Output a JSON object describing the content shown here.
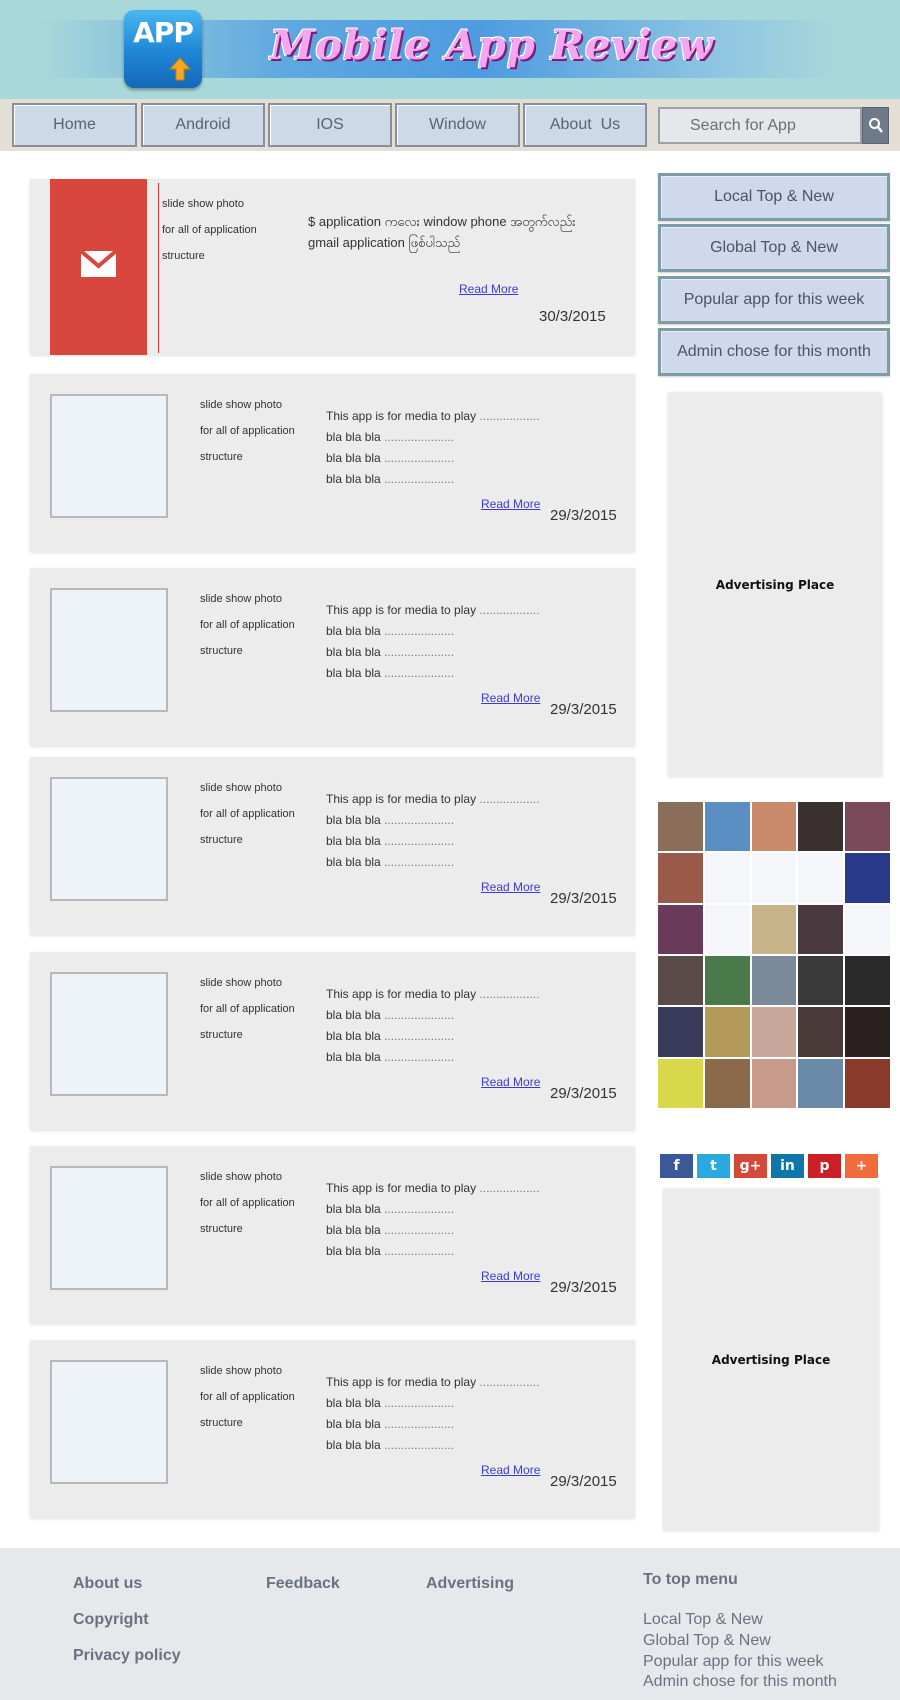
{
  "header": {
    "logo_text": "APP",
    "site_title": "Mobile App Review"
  },
  "nav": {
    "items": [
      "Home",
      "Android",
      "IOS",
      "Window",
      "About  Us"
    ],
    "search_placeholder": "Search for App"
  },
  "featured": {
    "meta": [
      "slide show photo",
      "for all of application",
      "structure"
    ],
    "description": "$ application ကလေး window phone အတွက်လည်း gmail application ဖြစ်ပါသည်",
    "read_more": "Read More",
    "date": "30/3/2015"
  },
  "posts": [
    {
      "meta": [
        "slide show photo",
        "for all of application",
        "structure"
      ],
      "lines": [
        "This app is for media to play",
        "bla bla bla",
        "bla bla bla",
        "bla bla bla"
      ],
      "read_more": "Read More",
      "date": "29/3/2015"
    },
    {
      "meta": [
        "slide show photo",
        "for all of application",
        "structure"
      ],
      "lines": [
        "This app is for media to play",
        "bla bla bla",
        "bla bla bla",
        "bla bla bla"
      ],
      "read_more": "Read More",
      "date": "29/3/2015"
    },
    {
      "meta": [
        "slide show photo",
        "for all of application",
        "structure"
      ],
      "lines": [
        "This app is for media to play",
        "bla bla bla",
        "bla bla bla",
        "bla bla bla"
      ],
      "read_more": "Read More",
      "date": "29/3/2015"
    },
    {
      "meta": [
        "slide show photo",
        "for all of application",
        "structure"
      ],
      "lines": [
        "This app is for media to play",
        "bla bla bla",
        "bla bla bla",
        "bla bla bla"
      ],
      "read_more": "Read More",
      "date": "29/3/2015"
    },
    {
      "meta": [
        "slide show photo",
        "for all of application",
        "structure"
      ],
      "lines": [
        "This app is for media to play",
        "bla bla bla",
        "bla bla bla",
        "bla bla bla"
      ],
      "read_more": "Read More",
      "date": "29/3/2015"
    },
    {
      "meta": [
        "slide show photo",
        "for all of application",
        "structure"
      ],
      "lines": [
        "This app is for media to play",
        "bla bla bla",
        "bla bla bla",
        "bla bla bla"
      ],
      "read_more": "Read More",
      "date": "29/3/2015"
    }
  ],
  "sidebar": {
    "buttons": [
      "Local Top & New",
      "Global Top & New",
      "Popular app for this week",
      "Admin chose for this month"
    ],
    "ad_label_1": "Advertising Place",
    "ad_label_2": "Advertising Place",
    "social": [
      {
        "icon": "facebook-icon",
        "glyph": "f",
        "color": "#3b5998"
      },
      {
        "icon": "twitter-icon",
        "glyph": "t",
        "color": "#2aa9e0"
      },
      {
        "icon": "googleplus-icon",
        "glyph": "g+",
        "color": "#d34836"
      },
      {
        "icon": "linkedin-icon",
        "glyph": "in",
        "color": "#0e76a8"
      },
      {
        "icon": "pinterest-icon",
        "glyph": "p",
        "color": "#cb2027"
      },
      {
        "icon": "more-share-icon",
        "glyph": "+",
        "color": "#f26b3a"
      }
    ]
  },
  "footer": {
    "about": "About us",
    "feedback": "Feedback",
    "advertising": "Advertising",
    "copyright": "Copyright",
    "privacy": "Privacy policy",
    "to_top": "To top menu",
    "links": [
      "Local Top & New",
      "Global Top & New",
      "Popular app for this week",
      "Admin chose for this month"
    ]
  }
}
